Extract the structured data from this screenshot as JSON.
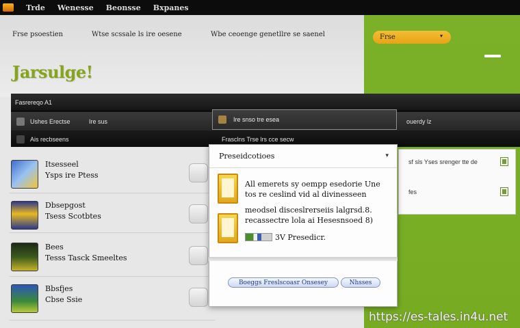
{
  "menubar": {
    "items": [
      "Trde",
      "Wenesse",
      "Beonsse",
      "Bxpanes"
    ]
  },
  "header": {
    "col1": "Frse psoestien",
    "col2": "Wtse scssale ls ire oesene",
    "col3": "Wbe ceoenge genetllre se saenel",
    "dropdown_label": "Frse",
    "title": "Jarsulge!"
  },
  "table": {
    "header": "Fasrereqo A1",
    "row2_cells": [
      "Ushes Erectse",
      "Ire sus",
      "Ire snso tre esea",
      "ouerdy lz"
    ],
    "row3_cells": [
      "Ais recbseens",
      "Frasclns Trse lrs cce secw"
    ]
  },
  "right_panel": {
    "rows": [
      "sf sls Yses srenger tte de",
      "fes"
    ]
  },
  "items": [
    {
      "line1": "Itsesseel",
      "line2": "Ysps ire Ptess"
    },
    {
      "line1": "Dbsepgost",
      "line2": "Tsess Scotbtes"
    },
    {
      "line1": "Bees",
      "line2": "Tesss Tasck Smeeltes"
    },
    {
      "line1": "Bbsfjes",
      "line2": "Cbse Ssie"
    }
  ],
  "dialog": {
    "title": "Preseidcotioes",
    "text1": "All emerets sy oempp esedorie Une tos re ceslind vid al divinesseen",
    "text2": "meodsel disceslrerseiis lalgrsd.8. recassectre lola ai Hesesnsoed 8)",
    "mini_label": "3V Presedicr.",
    "btn_primary": "Boeggs Freslscoasr Onsesey",
    "btn_secondary": "Nhsses"
  },
  "watermark": "https://es-tales.in4u.net",
  "colors": {
    "green": "#7ab128",
    "accent": "#f4bc36",
    "title": "#86a51c"
  }
}
